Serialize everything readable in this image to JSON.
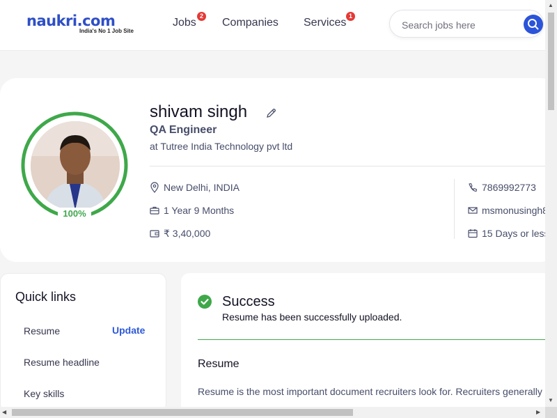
{
  "header": {
    "logo_text": "naukri.com",
    "logo_tagline": "India's No 1 Job Site",
    "nav": [
      {
        "label": "Jobs",
        "badge": "2"
      },
      {
        "label": "Companies",
        "badge": ""
      },
      {
        "label": "Services",
        "badge": "1"
      }
    ],
    "search_placeholder": "Search jobs here"
  },
  "profile": {
    "name": "shivam singh",
    "designation": "QA Engineer",
    "company": "at Tutree India Technology pvt ltd",
    "completion": "100%",
    "completion_fraction": 1.0,
    "location": "New Delhi, INDIA",
    "experience": "1 Year 9 Months",
    "salary": "₹ 3,40,000",
    "phone": "7869992773",
    "email": "msmonusingh8",
    "notice": "15 Days or less"
  },
  "quick_links": {
    "title": "Quick links",
    "items": [
      {
        "label": "Resume",
        "action": "Update"
      },
      {
        "label": "Resume headline",
        "action": ""
      },
      {
        "label": "Key skills",
        "action": ""
      }
    ]
  },
  "alert": {
    "title": "Success",
    "message": "Resume has been successfully uploaded."
  },
  "resume_section": {
    "heading": "Resume",
    "description": "Resume is the most important document recruiters look for. Recruiters generally"
  },
  "colors": {
    "brand_blue": "#2e4fc6",
    "success_green": "#3fa84a",
    "badge_red": "#e53935"
  }
}
